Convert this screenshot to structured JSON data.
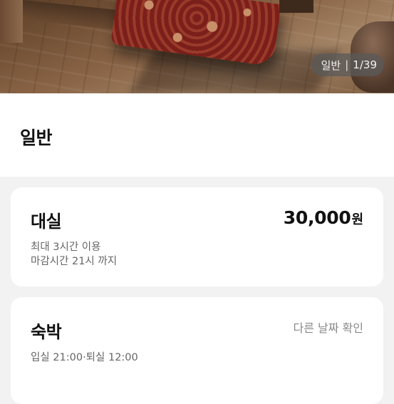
{
  "gallery": {
    "image_category": "일반",
    "current": "1",
    "total": "39",
    "separator": "|"
  },
  "room": {
    "title": "일반"
  },
  "rest": {
    "title": "대실",
    "price": "30,000",
    "currency": "원",
    "details": [
      "최대 3시간 이용",
      "마감시간 21시 까지"
    ]
  },
  "stay": {
    "title": "숙박",
    "other_date_label": "다른 날짜 확인",
    "checkin_checkout": "입실 21:00·퇴실 12:00"
  }
}
